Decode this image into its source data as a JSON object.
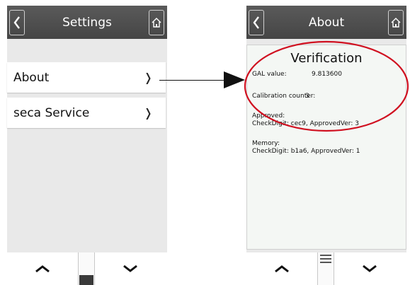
{
  "left_screen": {
    "title": "Settings",
    "menu": [
      {
        "label": "About",
        "chevron": "❭"
      },
      {
        "label": "seca Service",
        "chevron": "❭"
      }
    ]
  },
  "right_screen": {
    "title": "About",
    "verification_title": "Verification",
    "gal_label": "GAL value:",
    "gal_value": "9.813600",
    "calibration_label": "Calibration counter:",
    "calibration_value": "3",
    "approved_label": "Approved:",
    "approved_line": "CheckDigit: cec9, ApprovedVer: 3",
    "memory_label": "Memory:",
    "memory_line": "CheckDigit: b1a6, ApprovedVer: 1"
  },
  "icons": {
    "back": "chevron-left-icon",
    "home": "home-icon",
    "scroll_up": "chevron-up-icon",
    "scroll_down": "chevron-down-icon"
  },
  "colors": {
    "titlebar": "#4f4f4f",
    "background": "#e9e9e9",
    "highlight": "#d01020",
    "annotation": "#111111"
  }
}
